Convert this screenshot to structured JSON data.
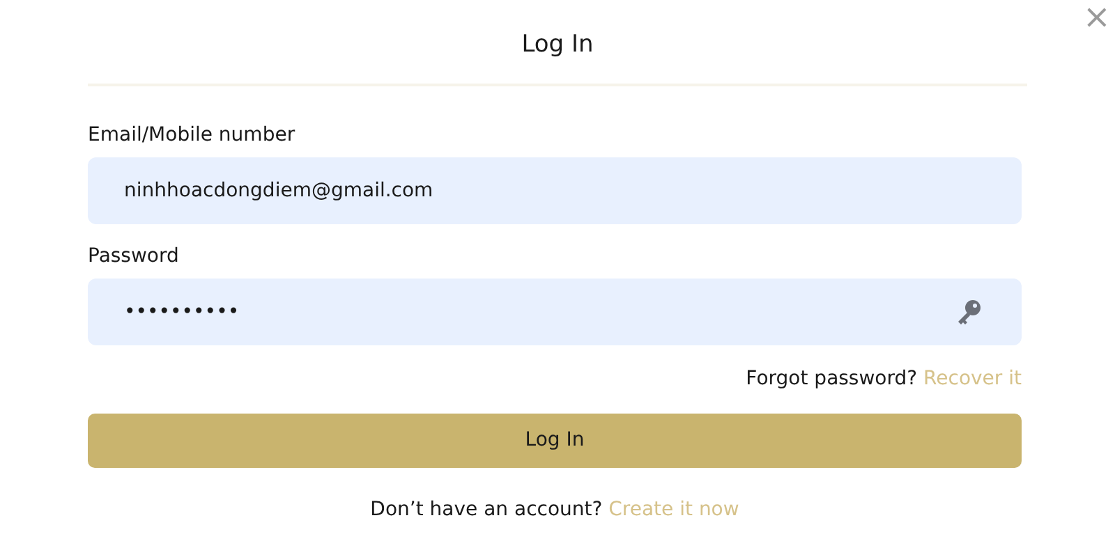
{
  "dialog": {
    "title": "Log In",
    "close": "×"
  },
  "fields": [
    {
      "label": "Email/Mobile number",
      "value": "ninhhoacdongdiem@gmail.com",
      "kind": "text"
    },
    {
      "label": "Password",
      "value": "••••••••••",
      "kind": "password"
    }
  ],
  "forgot": {
    "text": "Forgot password?",
    "link": "Recover it"
  },
  "submit": "Log In",
  "signup": {
    "text": "Don’t have an account?",
    "link": "Create it now"
  }
}
